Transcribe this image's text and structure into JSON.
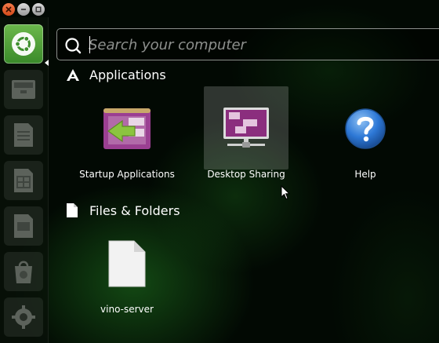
{
  "search": {
    "placeholder": "Search your computer"
  },
  "sections": {
    "applications": {
      "title": "Applications",
      "items": [
        {
          "label": "Startup Applications",
          "icon": "startup-applications-icon"
        },
        {
          "label": "Desktop Sharing",
          "icon": "desktop-sharing-icon",
          "selected": true
        },
        {
          "label": "Help",
          "icon": "help-icon"
        }
      ]
    },
    "files": {
      "title": "Files & Folders",
      "items": [
        {
          "label": "vino-server",
          "icon": "file-icon"
        }
      ]
    }
  },
  "launcher": {
    "items": [
      "dash-home-icon",
      "files-icon",
      "writer-icon",
      "calc-icon",
      "impress-icon",
      "software-center-icon",
      "settings-icon"
    ]
  },
  "colors": {
    "accent_green": "#4a9a36",
    "close_orange": "#e2602a",
    "purple": "#8b2e7e",
    "help_blue": "#2d78d6"
  }
}
